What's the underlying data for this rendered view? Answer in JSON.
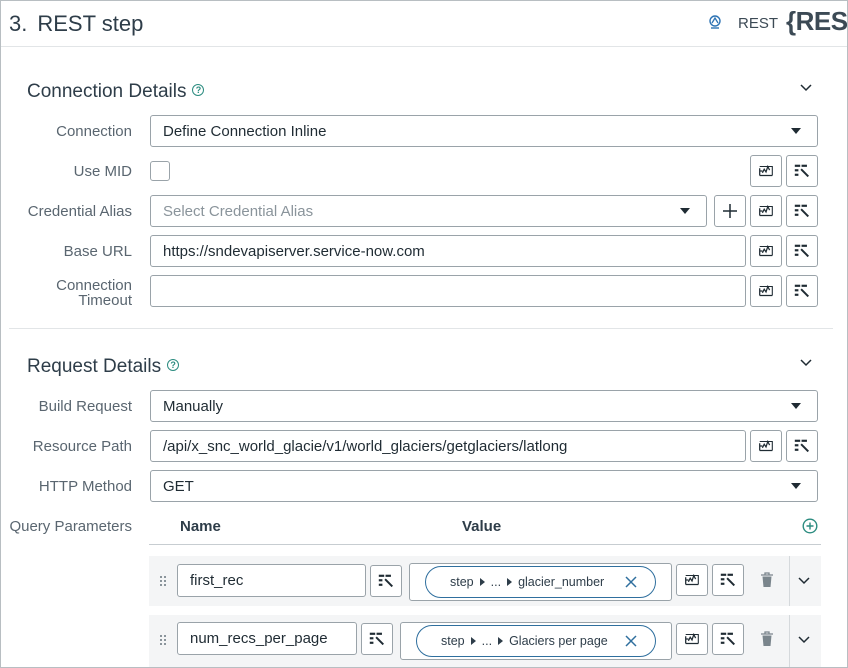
{
  "header": {
    "step_number": "3.",
    "title": "REST step",
    "badge_label": "REST",
    "logo_text": "{REST}"
  },
  "connection": {
    "section_title": "Connection Details",
    "help_icon": "question-circle-icon",
    "connection_label": "Connection",
    "connection_value": "Define Connection Inline",
    "use_mid_label": "Use MID",
    "use_mid_checked": false,
    "credential_alias_label": "Credential Alias",
    "credential_alias_placeholder": "Select Credential Alias",
    "base_url_label": "Base URL",
    "base_url_value": "https://sndevapiserver.service-now.com",
    "connection_timeout_label_1": "Connection",
    "connection_timeout_label_2": "Timeout",
    "connection_timeout_value": ""
  },
  "request": {
    "section_title": "Request Details",
    "build_request_label": "Build Request",
    "build_request_value": "Manually",
    "resource_path_label": "Resource Path",
    "resource_path_value": "/api/x_snc_world_glacie/v1/world_glaciers/getglaciers/latlong",
    "http_method_label": "HTTP Method",
    "http_method_value": "GET",
    "query_params_label": "Query Parameters",
    "col_name": "Name",
    "col_value": "Value",
    "params": [
      {
        "name": "first_rec",
        "pill_start": "step",
        "pill_mid": "...",
        "pill_end": "glacier_number"
      },
      {
        "name": "num_recs_per_page",
        "pill_start": "step",
        "pill_mid": "...",
        "pill_end": "Glaciers per page"
      }
    ]
  },
  "colors": {
    "accent_teal": "#2c8c80",
    "pill_border": "#2f6f9e",
    "link_blue": "#2f74b4"
  }
}
